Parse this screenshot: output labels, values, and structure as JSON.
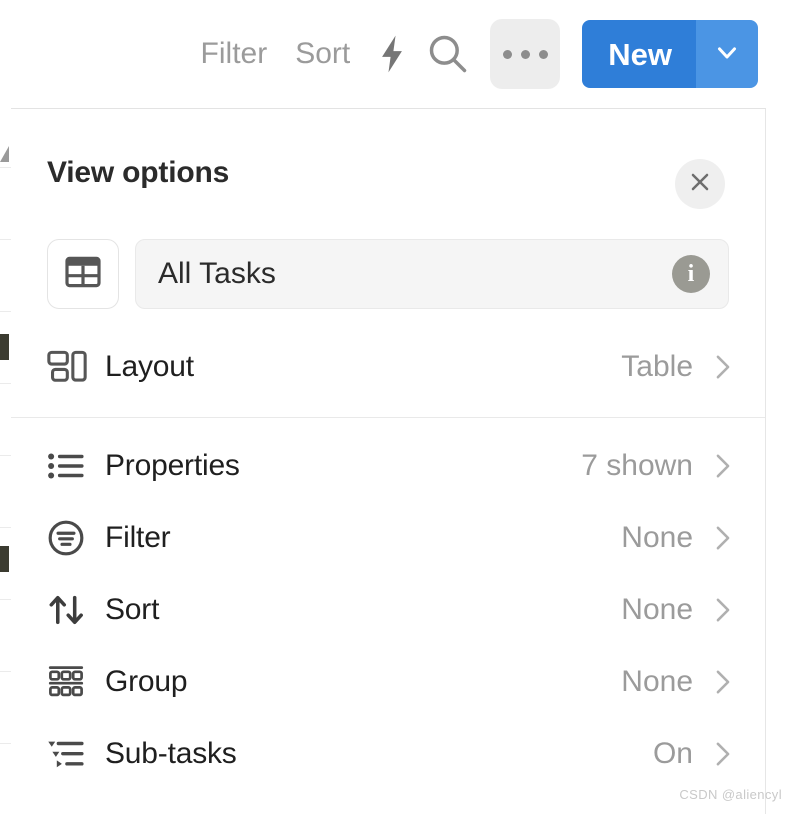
{
  "toolbar": {
    "filter_label": "Filter",
    "sort_label": "Sort",
    "lightning_icon": "lightning-bolt-icon",
    "search_icon": "search-icon",
    "more_icon": "ellipsis-icon",
    "new_label": "New",
    "new_caret_icon": "chevron-down-icon",
    "accent_color": "#2f7ed8",
    "accent_color_light": "#4b95e4"
  },
  "panel": {
    "title": "View options",
    "close_icon": "close-icon",
    "view": {
      "type_icon": "table-icon",
      "name": "All Tasks",
      "info_icon": "info-icon"
    },
    "layout_row": {
      "icon": "layout-icon",
      "label": "Layout",
      "value": "Table",
      "chevron": "chevron-right-icon"
    },
    "options": [
      {
        "icon": "properties-list-icon",
        "label": "Properties",
        "value": "7 shown",
        "chevron": "chevron-right-icon"
      },
      {
        "icon": "filter-circle-icon",
        "label": "Filter",
        "value": "None",
        "chevron": "chevron-right-icon"
      },
      {
        "icon": "sort-arrows-icon",
        "label": "Sort",
        "value": "None",
        "chevron": "chevron-right-icon"
      },
      {
        "icon": "group-grid-icon",
        "label": "Group",
        "value": "None",
        "chevron": "chevron-right-icon"
      },
      {
        "icon": "sub-tasks-icon",
        "label": "Sub-tasks",
        "value": "On",
        "chevron": "chevron-right-icon"
      }
    ]
  },
  "watermark": "CSDN @aliencyl"
}
